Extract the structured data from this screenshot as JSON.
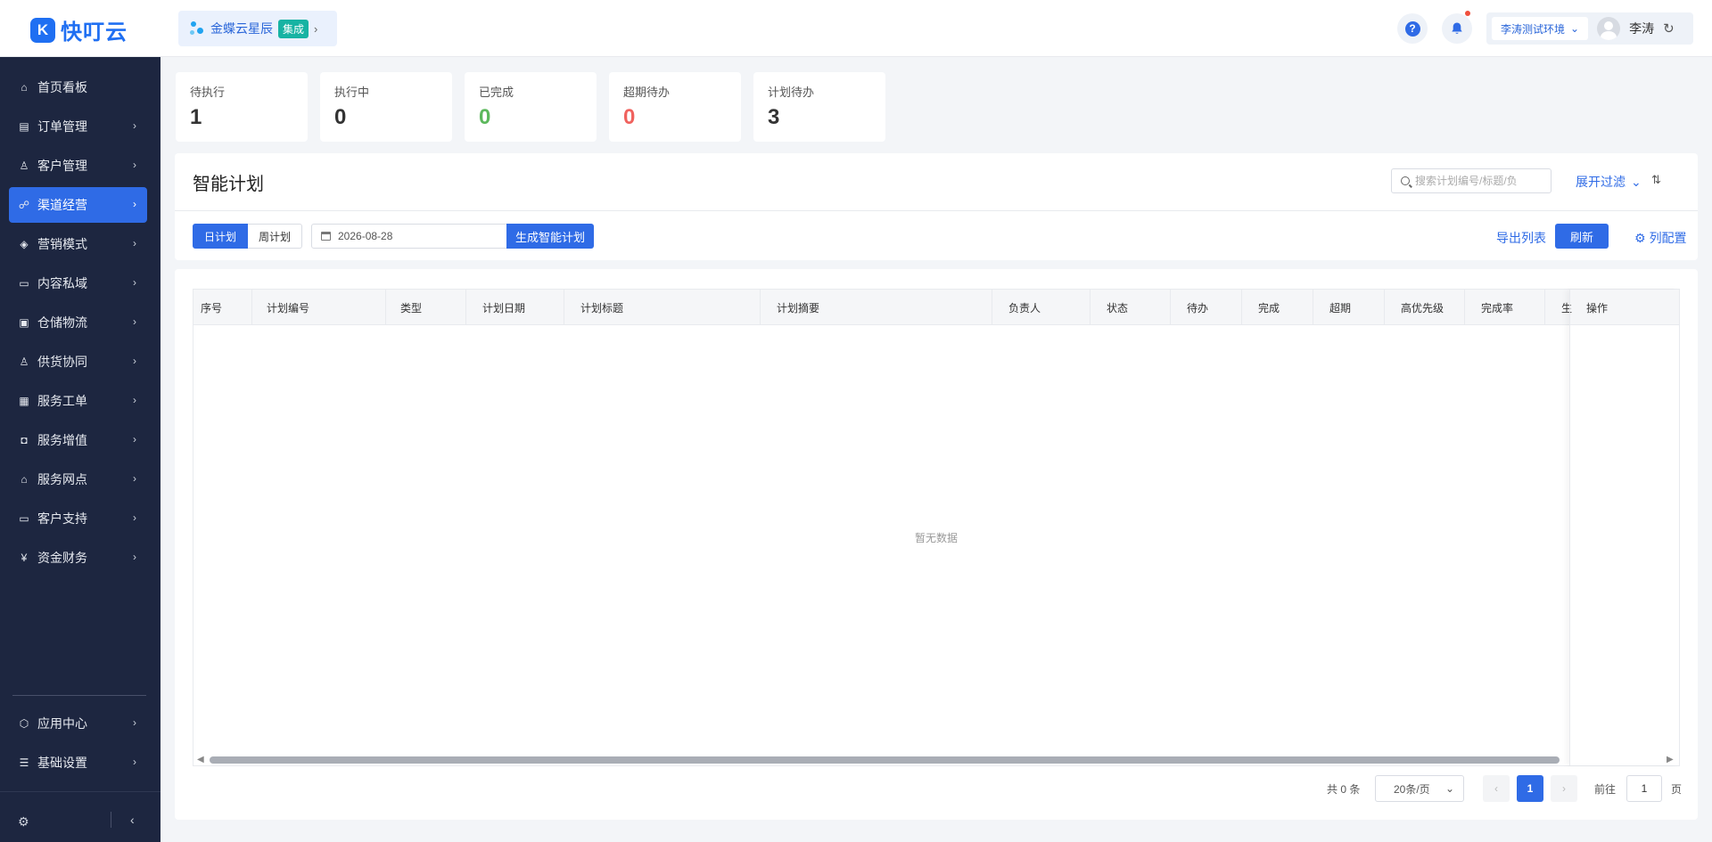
{
  "app": {
    "logo_text": "快叮云",
    "logo_mark": "K"
  },
  "header": {
    "org_name": "金蝶云星辰",
    "org_badge": "集成",
    "env_label": "李涛测试环境",
    "user_name": "李涛"
  },
  "sidebar": {
    "items": [
      {
        "label": "首页看板",
        "icon": "home-icon"
      },
      {
        "label": "订单管理",
        "icon": "order-icon"
      },
      {
        "label": "客户管理",
        "icon": "user-icon"
      },
      {
        "label": "渠道经营",
        "icon": "channel-icon"
      },
      {
        "label": "营销模式",
        "icon": "tag-icon"
      },
      {
        "label": "内容私域",
        "icon": "image-icon"
      },
      {
        "label": "仓储物流",
        "icon": "warehouse-icon"
      },
      {
        "label": "供货协同",
        "icon": "supply-icon"
      },
      {
        "label": "服务工单",
        "icon": "ticket-icon"
      },
      {
        "label": "服务增值",
        "icon": "bag-icon"
      },
      {
        "label": "服务网点",
        "icon": "store-icon"
      },
      {
        "label": "客户支持",
        "icon": "support-icon"
      },
      {
        "label": "资金财务",
        "icon": "yen-icon"
      },
      {
        "label": "应用中心",
        "icon": "cube-icon"
      },
      {
        "label": "基础设置",
        "icon": "settings-list-icon"
      }
    ],
    "active_index": 3
  },
  "stats": [
    {
      "label": "待执行",
      "value": "1",
      "color": "#333333"
    },
    {
      "label": "执行中",
      "value": "0",
      "color": "#333333"
    },
    {
      "label": "已完成",
      "value": "0",
      "color": "#5cb85c"
    },
    {
      "label": "超期待办",
      "value": "0",
      "color": "#f0625e"
    },
    {
      "label": "计划待办",
      "value": "3",
      "color": "#333333"
    }
  ],
  "plan": {
    "title": "智能计划",
    "search_placeholder": "搜索计划编号/标题/负",
    "expand_filter": "展开过滤",
    "tab_day": "日计划",
    "tab_week": "周计划",
    "date_value": "2026-08-28",
    "generate_label": "生成智能计划",
    "export_label": "导出列表",
    "refresh_label": "刷新",
    "column_config_label": "列配置"
  },
  "table": {
    "columns": [
      "序号",
      "计划编号",
      "类型",
      "计划日期",
      "计划标题",
      "计划摘要",
      "负责人",
      "状态",
      "待办",
      "完成",
      "超期",
      "高优先级",
      "完成率",
      "生成"
    ],
    "action_column": "操作",
    "empty_text": "暂无数据"
  },
  "pagination": {
    "total": "共 0 条",
    "page_size": "20条/页",
    "current_page": "1",
    "goto_label": "前往",
    "goto_value": "1",
    "page_suffix": "页"
  },
  "colors": {
    "accent": "#2f6be6",
    "sidebar_bg": "#1d2640"
  }
}
